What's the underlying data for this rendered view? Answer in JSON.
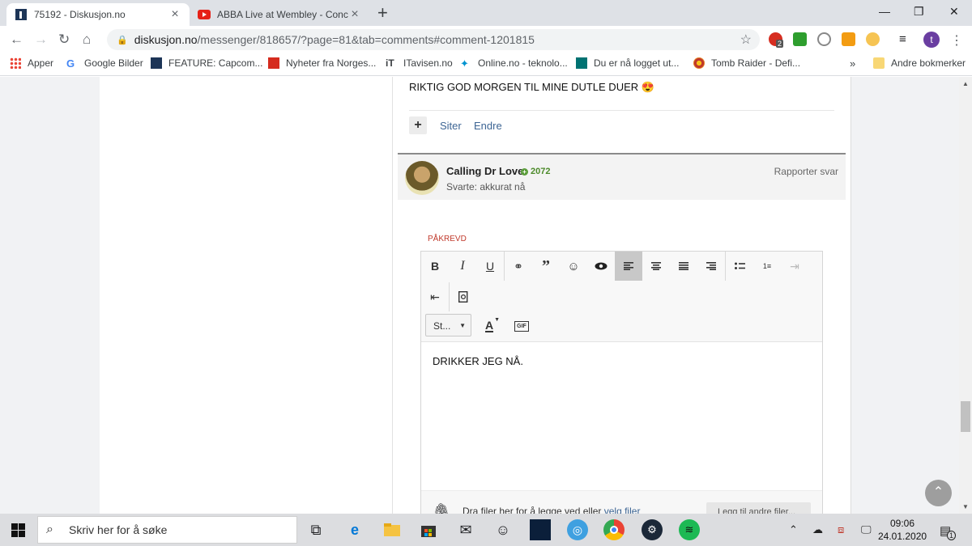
{
  "tabs": [
    {
      "title": "75192 - Diskusjon.no",
      "active": true
    },
    {
      "title": "ABBA Live at Wembley - Concert",
      "active": false
    }
  ],
  "address": {
    "host": "diskusjon.no",
    "path": "/messenger/818657/?page=81&tab=comments#comment-1201815"
  },
  "bookmarks": [
    {
      "label": "Apper",
      "icon": "apps-grid-icon"
    },
    {
      "label": "Google Bilder",
      "icon": "google-icon"
    },
    {
      "label": "FEATURE: Capcom...",
      "icon": "site-icon"
    },
    {
      "label": "Nyheter fra Norges...",
      "icon": "vg-icon"
    },
    {
      "label": "ITavisen.no",
      "icon": "it-icon"
    },
    {
      "label": "Online.no - teknolo...",
      "icon": "telenor-icon"
    },
    {
      "label": "Du er nå logget ut...",
      "icon": "dnb-icon"
    },
    {
      "label": "Tomb Raider - Defi...",
      "icon": "tomb-raider-icon"
    }
  ],
  "bookmarks_more": "»",
  "other_bookmarks": "Andre bokmerker",
  "ext_badge": "2",
  "profile_initial": "t",
  "post": {
    "text": "RIKTIG GOD MORGEN TIL MINE DUTLE DUER 😍",
    "quote": "Siter",
    "edit": "Endre"
  },
  "reply": {
    "author": "Calling Dr Love",
    "reputation": "2072",
    "answered": "Svarte: akkurat nå",
    "report": "Rapporter svar"
  },
  "editor": {
    "required": "PÅKREVD",
    "style_select": "St...",
    "gif_label": "GIF",
    "body": "DRIKKER JEG NÅ.",
    "drop_text": "Dra filer her for å legge ved eller ",
    "drop_link": "velg filer",
    "attach_button": "Legg til andre filer..."
  },
  "taskbar": {
    "search_placeholder": "Skriv her for å søke",
    "time": "09:06",
    "date": "24.01.2020",
    "notif_count": "1"
  },
  "colors": {
    "link": "#3d6594",
    "rep": "#4c8a2a",
    "required": "#c0392b"
  }
}
